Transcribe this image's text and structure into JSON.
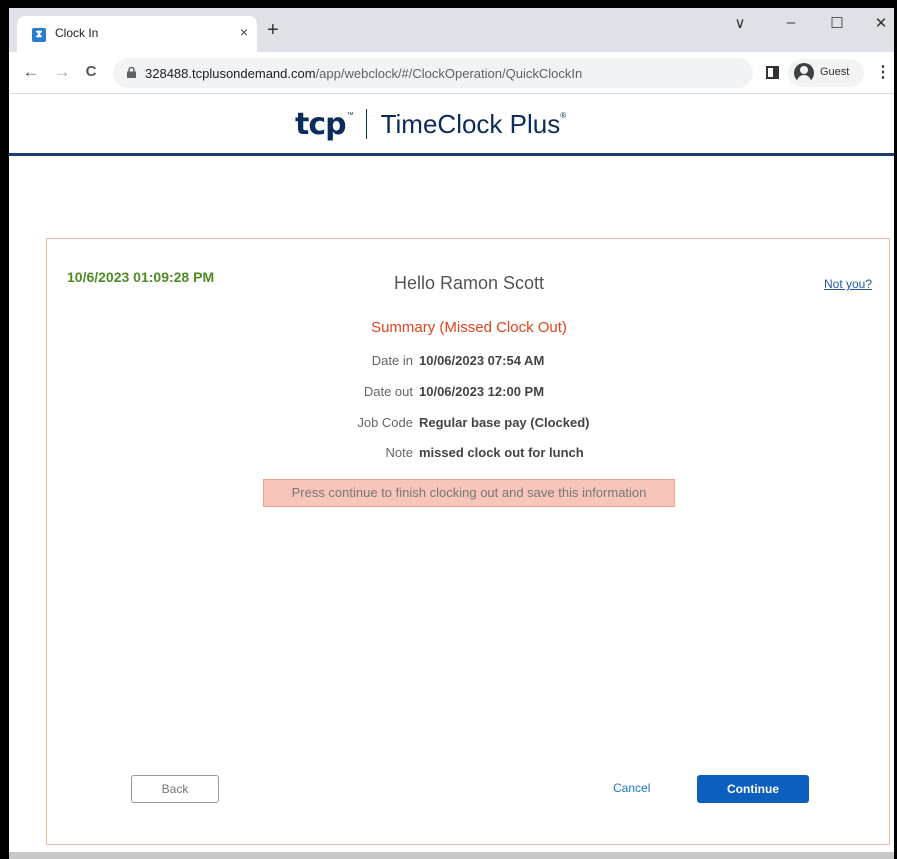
{
  "browser": {
    "tab_title": "Clock In",
    "tab_close": "×",
    "new_tab": "+",
    "window_controls": {
      "chevron": "∨",
      "minimize": "–",
      "maximize": "☐",
      "close": "✕"
    },
    "nav": {
      "back": "←",
      "forward": "→",
      "reload": "C"
    },
    "url_host": "328488.tcplusondemand.com",
    "url_path": "/app/webclock/#/ClockOperation/QuickClockIn",
    "profile_label": "Guest",
    "menu": "⋮"
  },
  "header": {
    "logo_mark": "tcp",
    "logo_tm": "™",
    "logo_name": "TimeClock Plus",
    "logo_reg": "®"
  },
  "main": {
    "clock": "10/6/2023 01:09:28 PM",
    "greeting": "Hello Ramon Scott",
    "not_you": "Not you?",
    "summary_title": "Summary (Missed Clock Out)",
    "rows": [
      {
        "label": "Date in",
        "value": "10/06/2023 07:54 AM"
      },
      {
        "label": "Date out",
        "value": "10/06/2023 12:00 PM"
      },
      {
        "label": "Job Code",
        "value": "Regular base pay (Clocked)"
      },
      {
        "label": "Note",
        "value": "missed clock out for lunch"
      }
    ],
    "notice": "Press continue to finish clocking out and save this information",
    "back_label": "Back",
    "cancel_label": "Cancel",
    "continue_label": "Continue"
  },
  "colors": {
    "accent_green": "#4f8a23",
    "accent_red": "#e0441d",
    "primary_blue": "#0c5fbd",
    "brand_navy": "#0b2d5a"
  }
}
